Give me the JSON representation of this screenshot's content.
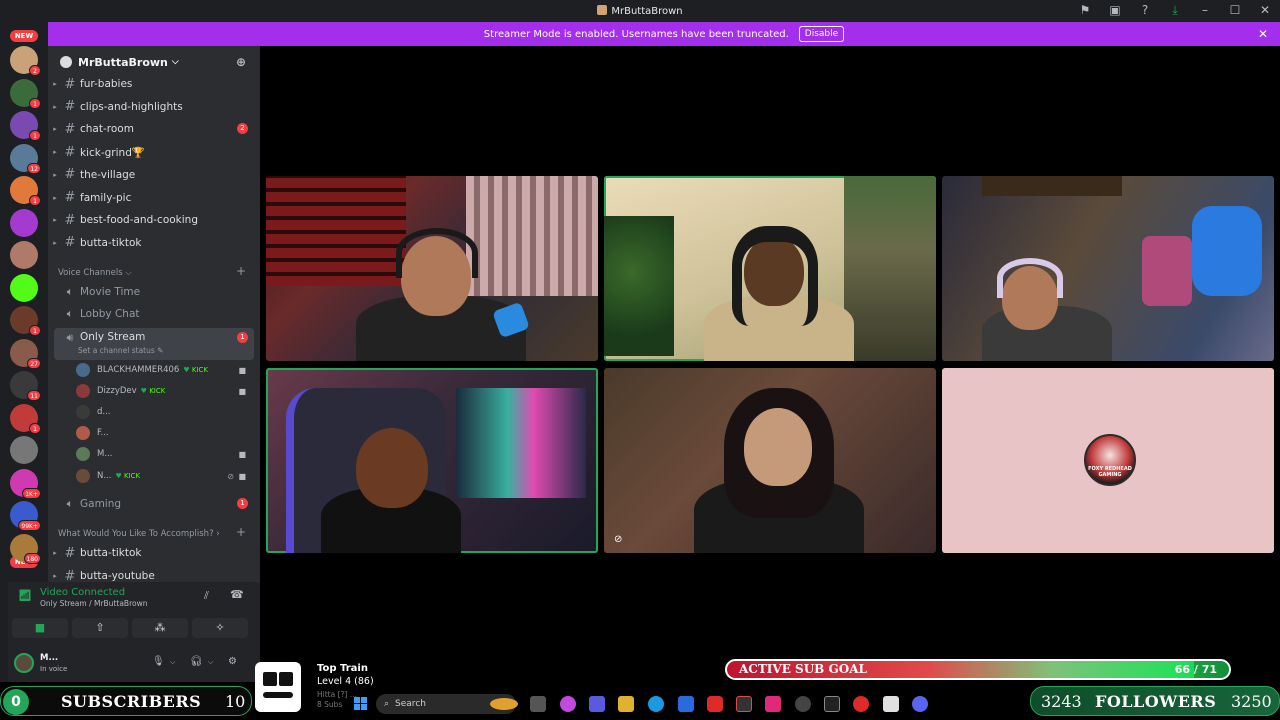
{
  "window": {
    "title": "MrButtaBrown"
  },
  "banner": {
    "text": "Streamer Mode is enabled. Usernames have been truncated.",
    "button": "Disable"
  },
  "rail": {
    "new_top": "NEW",
    "new_bottom": "NEW",
    "servers": [
      {
        "color": "#c9a27a",
        "badge": "2"
      },
      {
        "color": "#3a6b3a",
        "badge": "1"
      },
      {
        "color": "#7a4ab0",
        "badge": "1"
      },
      {
        "color": "#5a7a9a",
        "badge": "12"
      },
      {
        "color": "#e07a3a",
        "badge": "1"
      },
      {
        "color": "#a53ad0",
        "badge": ""
      },
      {
        "color": "#b07a6a",
        "badge": ""
      },
      {
        "color": "#53fc18",
        "badge": ""
      },
      {
        "color": "#6a3a2a",
        "badge": "1"
      },
      {
        "color": "#8a5a4a",
        "badge": "27"
      },
      {
        "color": "#3a3a3a",
        "badge": "11"
      },
      {
        "color": "#c23b3b",
        "badge": "1"
      },
      {
        "color": "#777777",
        "badge": ""
      },
      {
        "color": "#d03ab0",
        "badge": "1K+"
      },
      {
        "color": "#3a5ad0",
        "badge": "99K+"
      },
      {
        "color": "#aa7a3a",
        "badge": "180"
      }
    ]
  },
  "server": {
    "name": "MrButtaBrown"
  },
  "channels": [
    {
      "name": "fur-babies",
      "count": ""
    },
    {
      "name": "clips-and-highlights",
      "count": ""
    },
    {
      "name": "chat-room",
      "count": "2"
    },
    {
      "name": "kick-grind🏆",
      "count": ""
    },
    {
      "name": "the-village",
      "count": ""
    },
    {
      "name": "family-pic",
      "count": ""
    },
    {
      "name": "best-food-and-cooking",
      "count": ""
    },
    {
      "name": "butta-tiktok",
      "count": ""
    }
  ],
  "voice_category": "Voice Channels",
  "voice_channels": {
    "movie": "Movie Time",
    "lobby": "Lobby Chat",
    "only_stream": "Only Stream",
    "only_stream_count": "1",
    "status_hint": "Set a channel status ✎",
    "gaming": "Gaming",
    "gaming_count": "1"
  },
  "voice_users": [
    {
      "name": "BLACKHAMMER406",
      "kick": "KICK",
      "color": "#4a6a8a"
    },
    {
      "name": "DizzyDev",
      "kick": "KICK",
      "color": "#8a3a3a"
    },
    {
      "name": "d...",
      "kick": "",
      "color": "#3a3a3a"
    },
    {
      "name": "F...",
      "kick": "",
      "color": "#b05a4a"
    },
    {
      "name": "M...",
      "kick": "",
      "color": "#5a7a5a"
    },
    {
      "name": "N...",
      "kick": "KICK",
      "color": "#6a4a3a"
    }
  ],
  "accomplish_category": "What Would You Like To Accomplish?",
  "bottom_channels": [
    "butta-tiktok",
    "butta-youtube"
  ],
  "voice_panel": {
    "title": "Video Connected",
    "subtitle": "Only Stream / MrButtaBrown"
  },
  "user": {
    "name": "M...",
    "status": "In voice"
  },
  "overlays": {
    "left_count": "0",
    "left_label": "SUBSCRIBERS",
    "left_goal": "10",
    "train_title": "Top Train",
    "train_level": "Level 4  (86)",
    "train_extra1": "Hitta [?] ...",
    "train_extra2": "8 Subs",
    "goal_label": "ACTIVE SUB GOAL",
    "goal_count": "66 / 71",
    "goal_current": 66,
    "goal_target": 71,
    "right_current": "3243",
    "right_label": "FOLLOWERS",
    "right_goal": "3250"
  },
  "avatar_tile": {
    "logo_text": "FOXY REDHEAD GAMING"
  },
  "taskbar": {
    "search_placeholder": "Search"
  },
  "colors": {
    "accent": "#23a55a",
    "banner": "#a32eec",
    "badge": "#f23f43"
  }
}
